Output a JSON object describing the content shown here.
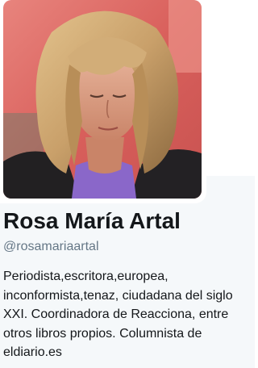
{
  "profile": {
    "name": "Rosa María Artal",
    "handle": "@rosamariaartal",
    "bio": "Periodista,escritora,europea, inconformista,tenaz, ciudadana del siglo XXI. Coordinadora de Reacciona, entre otros libros propios. Columnista de eldiario.es",
    "avatar_icon": "profile-photo"
  },
  "colors": {
    "name": "#14171a",
    "handle": "#657786",
    "panel_background": "#f5f8fa"
  }
}
